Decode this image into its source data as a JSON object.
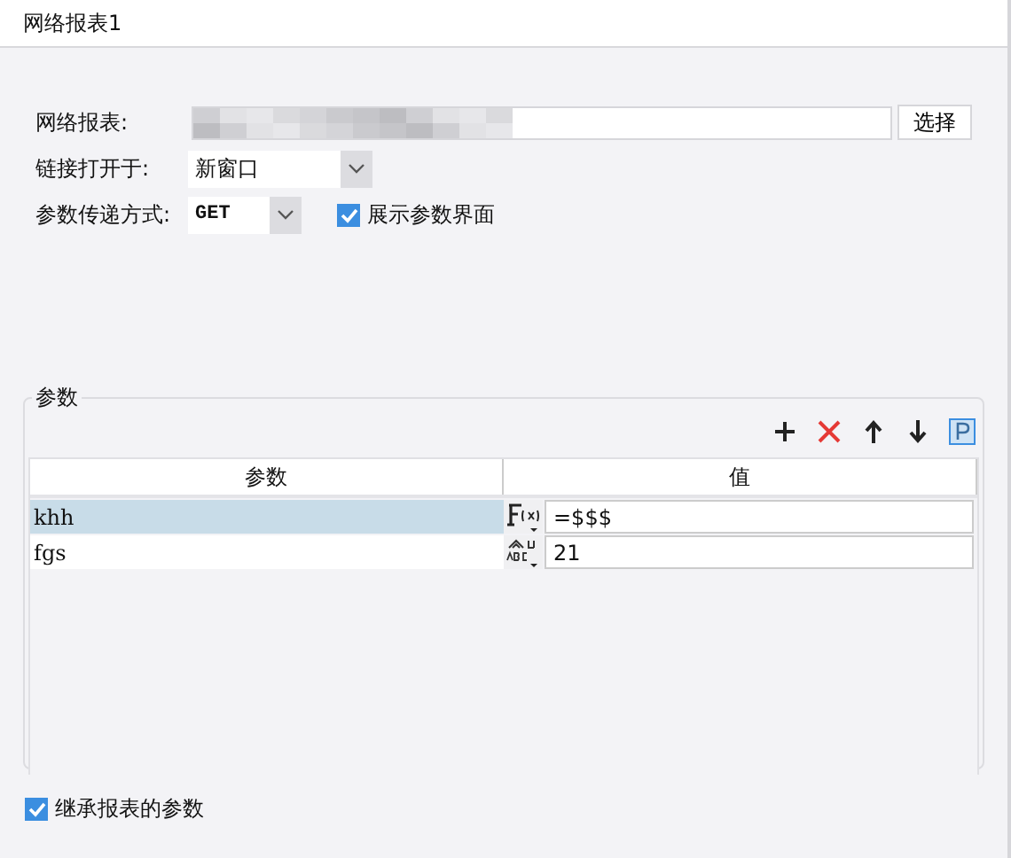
{
  "window": {
    "title": "网络报表1"
  },
  "form": {
    "report_label": "网络报表:",
    "select_button": "选择",
    "open_label": "链接打开于:",
    "open_value": "新窗口",
    "method_label": "参数传递方式:",
    "method_value": "GET",
    "show_params": {
      "label": "展示参数界面",
      "checked": true
    }
  },
  "params": {
    "title": "参数",
    "columns": [
      "参数",
      "值"
    ],
    "rows": [
      {
        "name": "khh",
        "kind": "formula",
        "value": "=$$$",
        "selected": true
      },
      {
        "name": "fgs",
        "kind": "text",
        "value": "21",
        "selected": false
      }
    ]
  },
  "inherit": {
    "label": "继承报表的参数",
    "checked": true
  }
}
